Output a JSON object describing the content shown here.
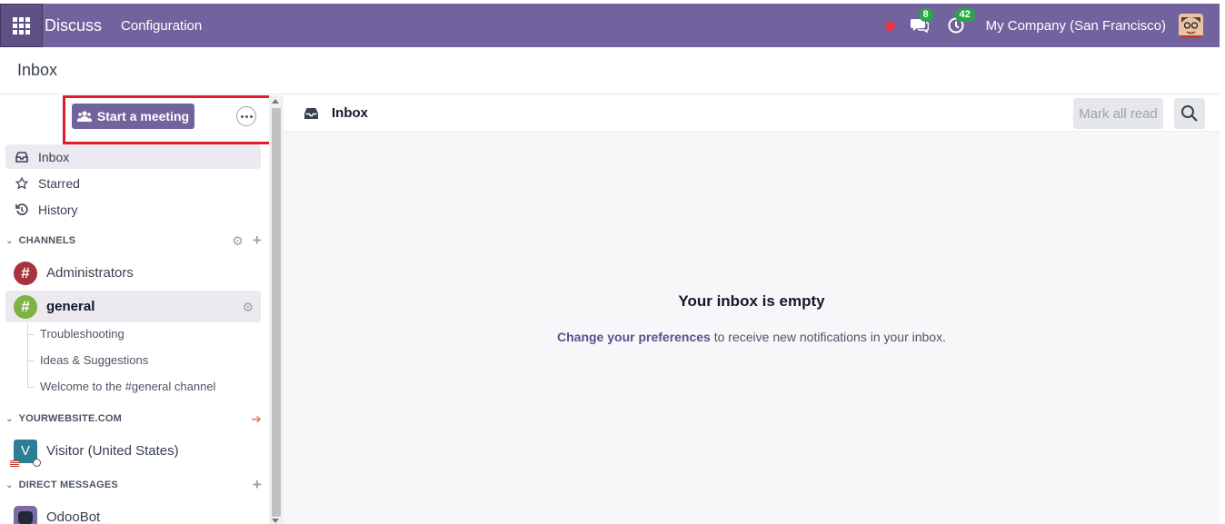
{
  "navbar": {
    "app_name": "Discuss",
    "menu_configuration": "Configuration",
    "messages_badge": "8",
    "activities_badge": "42",
    "company": "My Company (San Francisco)",
    "accent_color": "#71639e"
  },
  "control_panel": {
    "title": "Inbox"
  },
  "sidebar": {
    "start_meeting_label": "Start a meeting",
    "mailboxes": [
      {
        "label": "Inbox",
        "icon": "inbox-icon",
        "active": true
      },
      {
        "label": "Starred",
        "icon": "star-icon",
        "active": false
      },
      {
        "label": "History",
        "icon": "history-icon",
        "active": false
      }
    ],
    "channels_header": "CHANNELS",
    "channels": [
      {
        "name": "Administrators",
        "color": "#a83240"
      },
      {
        "name": "general",
        "color": "#7cb342",
        "active": true
      }
    ],
    "threads": [
      "Troubleshooting",
      "Ideas & Suggestions",
      "Welcome to the #general channel"
    ],
    "website_header": "YOURWEBSITE.COM",
    "visitor": {
      "initial": "V",
      "name": "Visitor (United States)"
    },
    "dm_header": "DIRECT MESSAGES",
    "dm": {
      "name": "OdooBot"
    }
  },
  "main": {
    "header_title": "Inbox",
    "mark_all_read": "Mark all read",
    "empty_title": "Your inbox is empty",
    "preferences_link": "Change your preferences",
    "empty_text": " to receive new notifications in your inbox."
  }
}
